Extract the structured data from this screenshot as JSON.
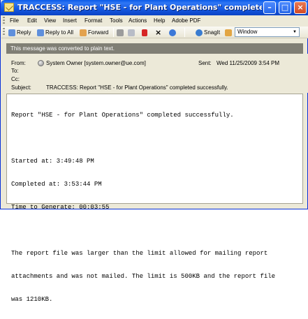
{
  "window": {
    "title": "TRACCESS: Report \"HSE - for Plant Operations\" completed successfully. - Message (...",
    "buttons": [
      "minimize",
      "maximize",
      "close"
    ]
  },
  "menu": [
    "File",
    "Edit",
    "View",
    "Insert",
    "Format",
    "Tools",
    "Actions",
    "Help",
    "Adobe PDF"
  ],
  "toolbar": {
    "reply": "Reply",
    "reply_all": "Reply to All",
    "forward": "Forward",
    "snagit": "SnagIt",
    "window_select": "Window"
  },
  "notice": "This message was converted to plain text.",
  "headers": {
    "from_label": "From:",
    "from_value": "System Owner [system.owner@ue.com]",
    "to_label": "To:",
    "cc_label": "Cc:",
    "subject_label": "Subject:",
    "subject_value": "TRACCESS: Report \"HSE - for Plant Operations\" completed successfully.",
    "sent_label": "Sent:",
    "sent_value": "Wed 11/25/2009 3:54 PM"
  },
  "body_lines": [
    "Report \"HSE - for Plant Operations\" completed successfully.",
    "",
    "Started at: 3:49:48 PM",
    "Completed at: 3:53:44 PM",
    "Time to Generate: 00:03:55",
    "",
    "The report file was larger than the limit allowed for mailing report",
    "attachments and was not mailed. The limit is 500KB and the report file",
    "was 1210KB."
  ]
}
